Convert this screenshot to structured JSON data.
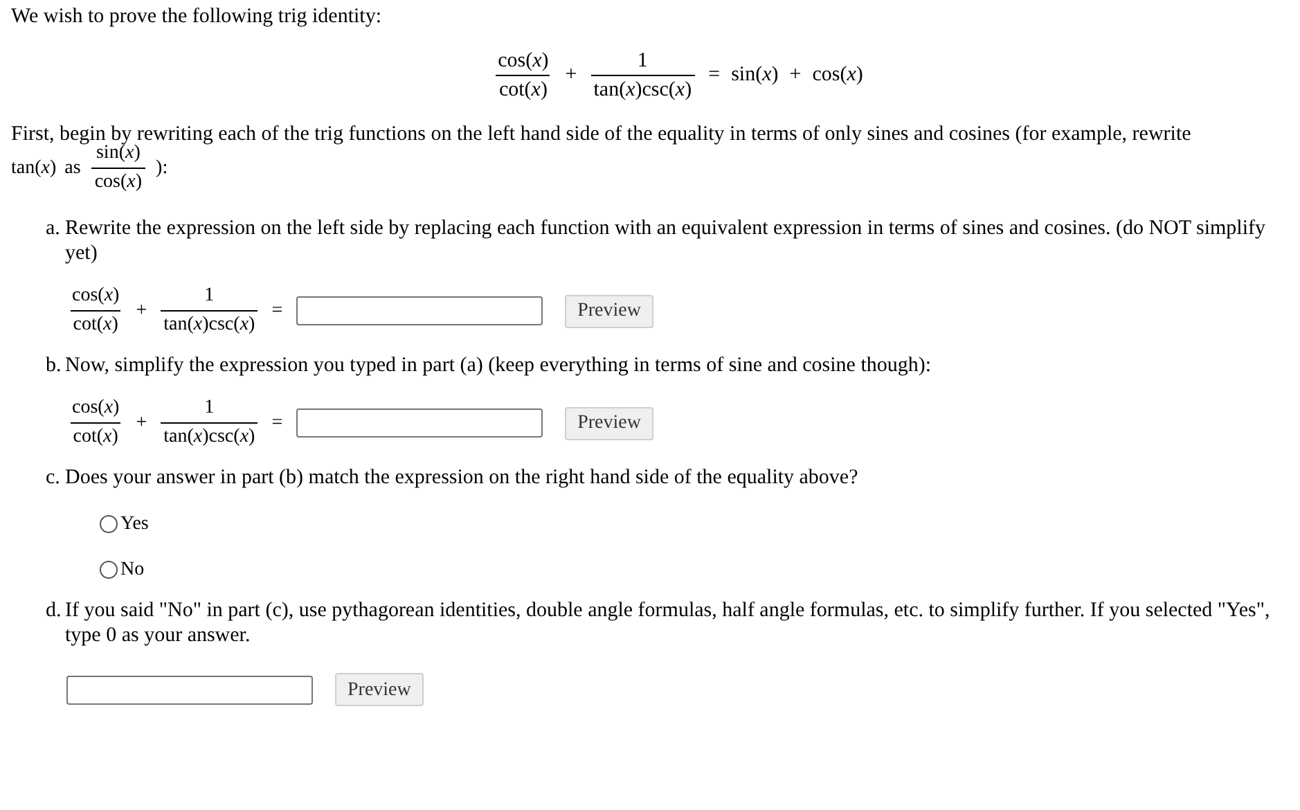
{
  "intro": "We wish to prove the following trig identity:",
  "identity": [
    {
      "kind": "frac",
      "num": "cos(*x*)",
      "den": "cot(*x*)"
    },
    {
      "kind": "op",
      "text": "+"
    },
    {
      "kind": "frac",
      "num": "1",
      "den": "tan(*x*)csc(*x*)"
    },
    {
      "kind": "op",
      "text": "="
    },
    {
      "kind": "expr",
      "text": "sin(*x*)"
    },
    {
      "kind": "op",
      "text": "+"
    },
    {
      "kind": "expr",
      "text": "cos(*x*)"
    }
  ],
  "instruction": {
    "text": "First, begin by rewriting each of the trig functions on the left hand side of the equality in terms of only sines and cosines (for example, rewrite",
    "example": [
      {
        "kind": "expr",
        "text": "tan(*x*)"
      },
      {
        "kind": "word",
        "text": "as"
      },
      {
        "kind": "frac",
        "num": "sin(*x*)",
        "den": "cos(*x*)"
      },
      {
        "kind": "word",
        "text": "):"
      }
    ]
  },
  "parts": [
    {
      "kind": "equation",
      "label": "a.",
      "text": "Rewrite the expression on the left side by replacing each function with an equivalent expression in terms of sines and cosines. (do NOT simplify yet)",
      "lhs": [
        {
          "kind": "frac",
          "num": "cos(*x*)",
          "den": "cot(*x*)"
        },
        {
          "kind": "op",
          "text": "+"
        },
        {
          "kind": "frac",
          "num": "1",
          "den": "tan(*x*)csc(*x*)"
        },
        {
          "kind": "op",
          "text": "="
        }
      ],
      "button": "Preview"
    },
    {
      "kind": "equation",
      "label": "b.",
      "text": "Now, simplify the expression you typed in part (a) (keep everything in terms of sine and cosine though):",
      "lhs": [
        {
          "kind": "frac",
          "num": "cos(*x*)",
          "den": "cot(*x*)"
        },
        {
          "kind": "op",
          "text": "+"
        },
        {
          "kind": "frac",
          "num": "1",
          "den": "tan(*x*)csc(*x*)"
        },
        {
          "kind": "op",
          "text": "="
        }
      ],
      "button": "Preview"
    },
    {
      "kind": "radio",
      "label": "c.",
      "text": "Does your answer in part (b) match the expression on the right hand side of the equality above?",
      "options": [
        {
          "label": "Yes",
          "selected": false
        },
        {
          "label": "No",
          "selected": false
        }
      ]
    },
    {
      "kind": "answer",
      "label": "d.",
      "text": "If you said \"No\" in part (c), use pythagorean identities, double angle formulas, half angle formulas, etc. to simplify further. If you selected \"Yes\", type 0 as your answer.",
      "button": "Preview"
    }
  ]
}
